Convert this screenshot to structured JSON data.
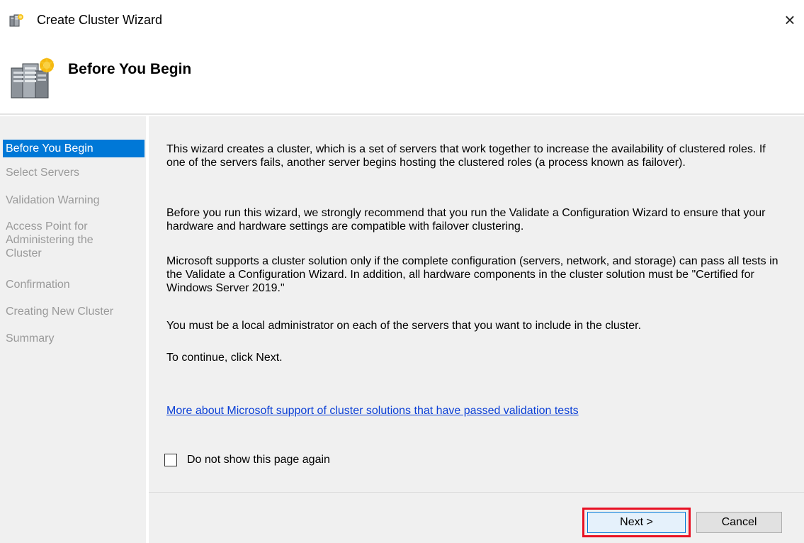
{
  "window": {
    "title": "Create Cluster Wizard",
    "close_glyph": "×",
    "icon": "cluster-server-icon"
  },
  "header": {
    "title": "Before You Begin",
    "icon": "cluster-servers-large-icon"
  },
  "nav": {
    "items": [
      {
        "label": "Before You Begin",
        "active": true
      },
      {
        "label": "Select Servers",
        "active": false
      },
      {
        "label": "Validation Warning",
        "active": false
      },
      {
        "label": "Access Point for Administering the Cluster",
        "active": false
      },
      {
        "label": "Confirmation",
        "active": false
      },
      {
        "label": "Creating New Cluster",
        "active": false
      },
      {
        "label": "Summary",
        "active": false
      }
    ]
  },
  "content": {
    "paragraphs": [
      "This wizard creates a cluster, which is a set of servers that work together to increase the availability of clustered roles. If one of the servers fails, another server begins hosting the clustered roles (a process known as failover).",
      "Before you run this wizard, we strongly recommend that you run the Validate a Configuration Wizard to ensure that your hardware and hardware settings are compatible with failover clustering.",
      "Microsoft supports a cluster solution only if the complete configuration (servers, network, and storage) can pass all tests in the Validate a Configuration Wizard. In addition, all hardware components in the cluster solution must be \"Certified for Windows Server 2019.\"",
      "You must be a local administrator on each of the servers that you want to include in the cluster.",
      "To continue, click Next."
    ],
    "link_text": "More about Microsoft support of cluster solutions that have passed validation tests",
    "checkbox_label": "Do not show this page again",
    "checkbox_checked": false
  },
  "footer": {
    "next_label": "Next >",
    "cancel_label": "Cancel",
    "highlight_color": "#e81123"
  },
  "colors": {
    "accent": "#0078d7",
    "pane_bg": "#f0f0f0",
    "link": "#0a3fd6",
    "disabled_text": "#9a9a9a"
  }
}
